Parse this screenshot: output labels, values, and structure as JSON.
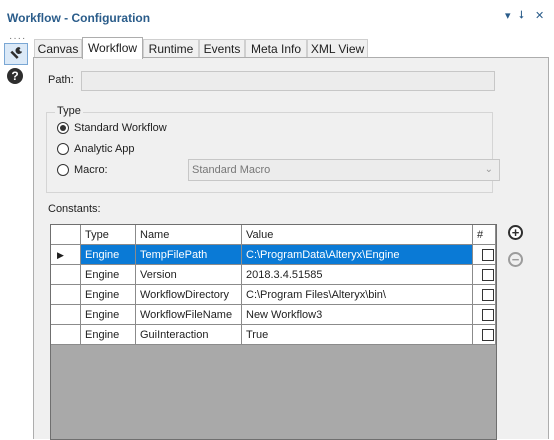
{
  "window": {
    "title": "Workflow - Configuration",
    "menu_glyph": "▾",
    "pin_glyph": "⭣",
    "close_glyph": "✕"
  },
  "left_strip": {
    "dots": "····",
    "help_glyph": "?"
  },
  "tabs": [
    {
      "label": "Canvas",
      "active": false
    },
    {
      "label": "Workflow",
      "active": true
    },
    {
      "label": "Runtime",
      "active": false
    },
    {
      "label": "Events",
      "active": false
    },
    {
      "label": "Meta Info",
      "active": false
    },
    {
      "label": "XML View",
      "active": false
    }
  ],
  "path": {
    "label": "Path:",
    "value": ""
  },
  "type_group": {
    "legend": "Type",
    "options": [
      {
        "label": "Standard Workflow",
        "checked": true
      },
      {
        "label": "Analytic App",
        "checked": false
      },
      {
        "label": "Macro:",
        "checked": false
      }
    ],
    "macro_select_value": "Standard Macro"
  },
  "constants": {
    "label": "Constants:",
    "columns": [
      "Type",
      "Name",
      "Value",
      "#"
    ],
    "rows": [
      {
        "type": "Engine",
        "name": "TempFilePath",
        "value": "C:\\ProgramData\\Alteryx\\Engine",
        "checked": false,
        "selected": true
      },
      {
        "type": "Engine",
        "name": "Version",
        "value": "2018.3.4.51585",
        "checked": false,
        "selected": false
      },
      {
        "type": "Engine",
        "name": "WorkflowDirectory",
        "value": "C:\\Program Files\\Alteryx\\bin\\",
        "checked": false,
        "selected": false
      },
      {
        "type": "Engine",
        "name": "WorkflowFileName",
        "value": "New Workflow3",
        "checked": false,
        "selected": false
      },
      {
        "type": "Engine",
        "name": "GuiInteraction",
        "value": "True",
        "checked": false,
        "selected": false
      }
    ],
    "add_glyph": "+",
    "remove_glyph": "−"
  }
}
